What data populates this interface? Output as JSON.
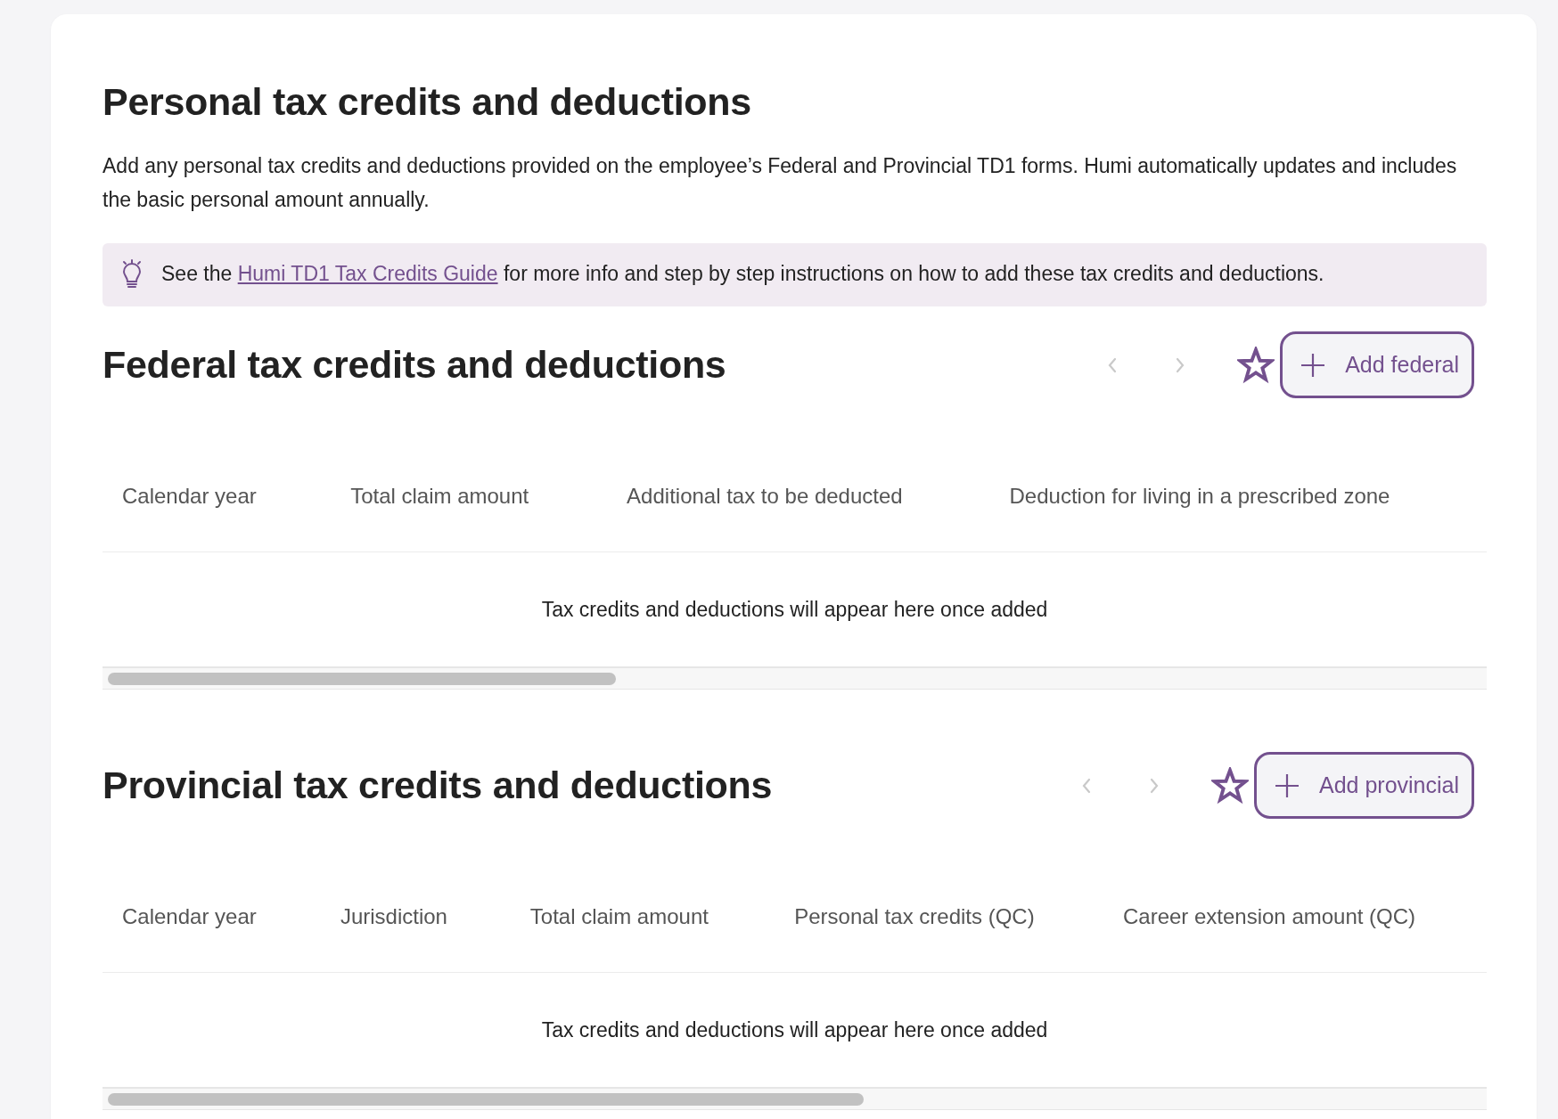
{
  "title": "Personal tax credits and deductions",
  "intro": "Add any personal tax credits and deductions provided on the employee’s Federal and Provincial TD1 forms. Humi automatically updates and includes the basic personal amount annually.",
  "tip": {
    "before": "See the ",
    "link": "Humi TD1 Tax Credits Guide",
    "after": " for more info and step by step instructions on how to add these tax credits and deductions."
  },
  "sections": [
    {
      "title": "Federal tax credits and deductions",
      "prev_disabled": true,
      "next_disabled": true,
      "add_button": "Add federal",
      "columns": [
        "Calendar year",
        "Total claim amount",
        "Additional tax to be deducted",
        "Deduction for living in a prescribed zone"
      ],
      "empty_message": "Tax credits and deductions will appear here once added"
    },
    {
      "title": "Provincial tax credits and deductions",
      "prev_disabled": true,
      "next_disabled": true,
      "add_button": "Add provincial",
      "columns": [
        "Calendar year",
        "Jurisdiction",
        "Total claim amount",
        "Personal tax credits (QC)",
        "Career extension amount (QC)"
      ],
      "empty_message": "Tax credits and deductions will appear here once added"
    }
  ]
}
